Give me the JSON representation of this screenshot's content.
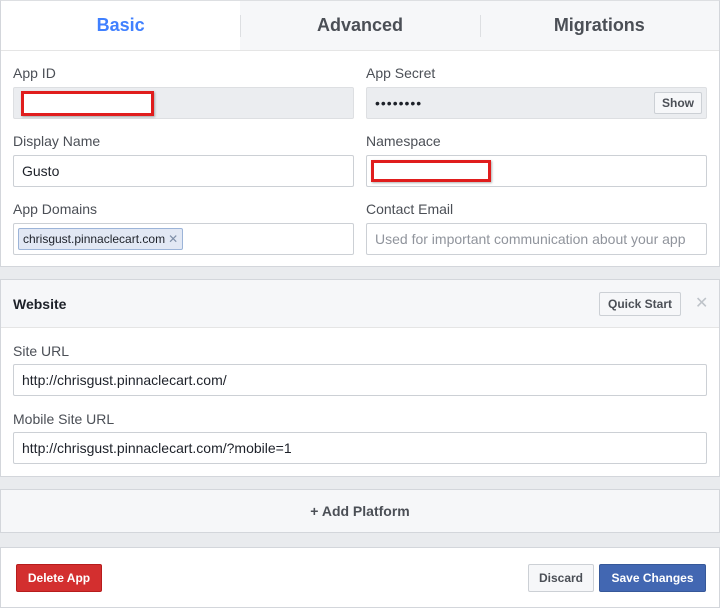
{
  "tabs": [
    {
      "label": "Basic"
    },
    {
      "label": "Advanced"
    },
    {
      "label": "Migrations"
    }
  ],
  "basic": {
    "app_id_label": "App ID",
    "app_secret_label": "App Secret",
    "app_secret_masked": "••••••••",
    "show_label": "Show",
    "display_name_label": "Display Name",
    "display_name_value": "Gusto",
    "namespace_label": "Namespace",
    "app_domains_label": "App Domains",
    "app_domain_tag": "chrisgust.pinnaclecart.com",
    "contact_email_label": "Contact Email",
    "contact_email_placeholder": "Used for important communication about your app"
  },
  "website": {
    "title": "Website",
    "quick_start_label": "Quick Start",
    "site_url_label": "Site URL",
    "site_url_value": "http://chrisgust.pinnaclecart.com/",
    "mobile_site_url_label": "Mobile Site URL",
    "mobile_site_url_value": "http://chrisgust.pinnaclecart.com/?mobile=1"
  },
  "add_platform_label": "+ Add Platform",
  "footer": {
    "delete_label": "Delete App",
    "discard_label": "Discard",
    "save_label": "Save Changes"
  },
  "colors": {
    "accent": "#4080ff",
    "primary_button": "#4267b2",
    "danger_button": "#d32f2f",
    "redaction": "#e01d1d"
  }
}
